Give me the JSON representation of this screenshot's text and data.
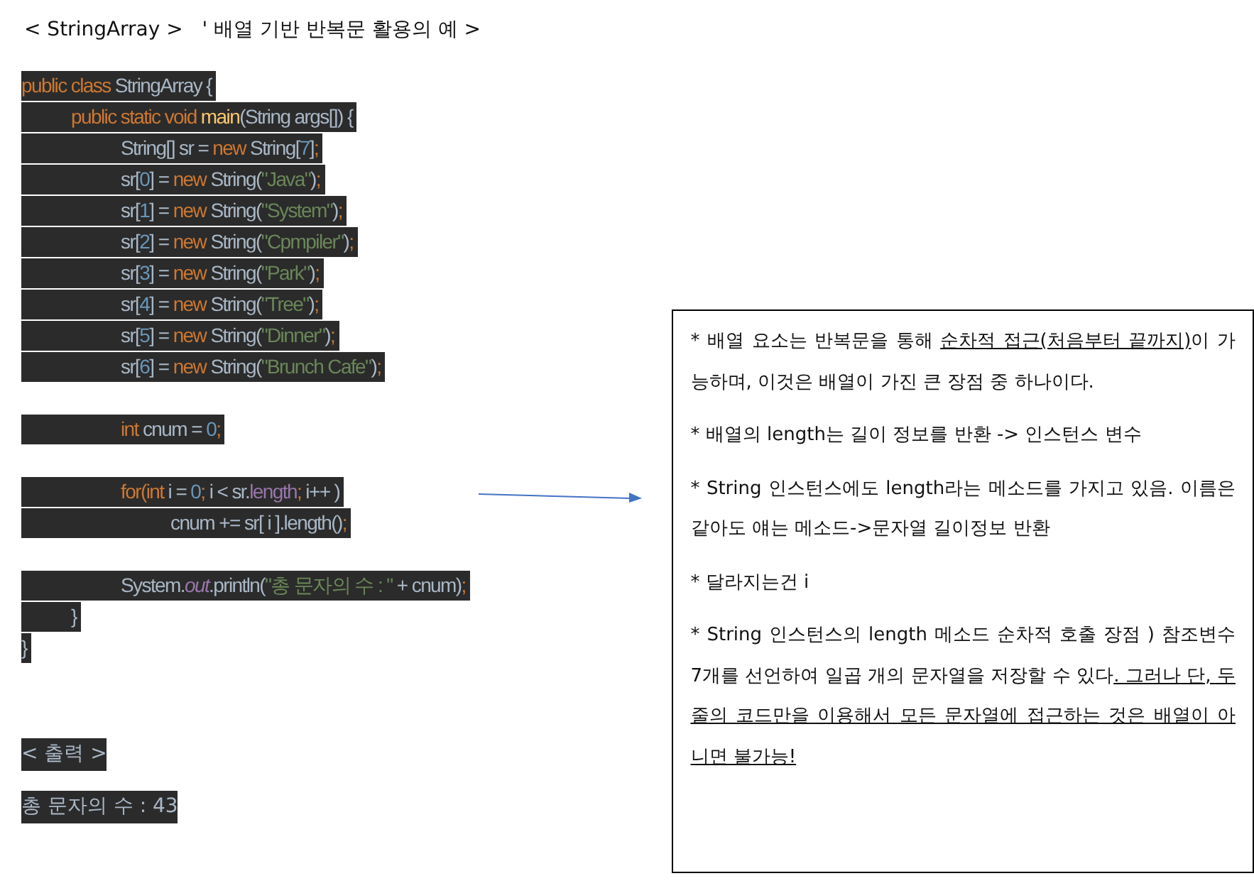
{
  "title": "< StringArray >   ' 배열 기반 반복문 활용의 예 >",
  "code": {
    "tokens": [
      {
        "kind": "keyword",
        "text": "public class "
      },
      {
        "kind": "plain",
        "text": "StringArray {"
      }
    ],
    "closing": [
      {
        "kind": "plain",
        "text": "}"
      }
    ],
    "groups": [
      [
        {
          "tokens": [
            {
              "kind": "keyword",
              "text": "public static void "
            },
            {
              "kind": "method",
              "text": "main"
            },
            {
              "kind": "plain",
              "text": "(String args[]) {"
            }
          ],
          "closing": [
            {
              "kind": "plain",
              "text": "}"
            }
          ],
          "groups": [
            [
              {
                "tokens": [
                  {
                    "kind": "plain",
                    "text": "String[] sr = "
                  },
                  {
                    "kind": "keyword",
                    "text": "new "
                  },
                  {
                    "kind": "plain",
                    "text": "String["
                  },
                  {
                    "kind": "number",
                    "text": "7"
                  },
                  {
                    "kind": "plain",
                    "text": "]"
                  },
                  {
                    "kind": "keyword",
                    "text": ";"
                  }
                ]
              },
              {
                "tokens": [
                  {
                    "kind": "plain",
                    "text": "sr["
                  },
                  {
                    "kind": "number",
                    "text": "0"
                  },
                  {
                    "kind": "plain",
                    "text": "] = "
                  },
                  {
                    "kind": "keyword",
                    "text": "new "
                  },
                  {
                    "kind": "plain",
                    "text": "String("
                  },
                  {
                    "kind": "string",
                    "text": "\"Java\""
                  },
                  {
                    "kind": "plain",
                    "text": ")"
                  },
                  {
                    "kind": "keyword",
                    "text": ";"
                  }
                ]
              },
              {
                "tokens": [
                  {
                    "kind": "plain",
                    "text": "sr["
                  },
                  {
                    "kind": "number",
                    "text": "1"
                  },
                  {
                    "kind": "plain",
                    "text": "] = "
                  },
                  {
                    "kind": "keyword",
                    "text": "new "
                  },
                  {
                    "kind": "plain",
                    "text": "String("
                  },
                  {
                    "kind": "string",
                    "text": "\"System\""
                  },
                  {
                    "kind": "plain",
                    "text": ")"
                  },
                  {
                    "kind": "keyword",
                    "text": ";"
                  }
                ]
              },
              {
                "tokens": [
                  {
                    "kind": "plain",
                    "text": "sr["
                  },
                  {
                    "kind": "number",
                    "text": "2"
                  },
                  {
                    "kind": "plain",
                    "text": "] = "
                  },
                  {
                    "kind": "keyword",
                    "text": "new "
                  },
                  {
                    "kind": "plain",
                    "text": "String("
                  },
                  {
                    "kind": "string",
                    "text": "\"Cpmpiler\""
                  },
                  {
                    "kind": "plain",
                    "text": ")"
                  },
                  {
                    "kind": "keyword",
                    "text": ";"
                  }
                ]
              },
              {
                "tokens": [
                  {
                    "kind": "plain",
                    "text": "sr["
                  },
                  {
                    "kind": "number",
                    "text": "3"
                  },
                  {
                    "kind": "plain",
                    "text": "] = "
                  },
                  {
                    "kind": "keyword",
                    "text": "new "
                  },
                  {
                    "kind": "plain",
                    "text": "String("
                  },
                  {
                    "kind": "string",
                    "text": "\"Park\""
                  },
                  {
                    "kind": "plain",
                    "text": ")"
                  },
                  {
                    "kind": "keyword",
                    "text": ";"
                  }
                ]
              },
              {
                "tokens": [
                  {
                    "kind": "plain",
                    "text": "sr["
                  },
                  {
                    "kind": "number",
                    "text": "4"
                  },
                  {
                    "kind": "plain",
                    "text": "] = "
                  },
                  {
                    "kind": "keyword",
                    "text": "new "
                  },
                  {
                    "kind": "plain",
                    "text": "String("
                  },
                  {
                    "kind": "string",
                    "text": "\"Tree\""
                  },
                  {
                    "kind": "plain",
                    "text": ")"
                  },
                  {
                    "kind": "keyword",
                    "text": ";"
                  }
                ]
              },
              {
                "tokens": [
                  {
                    "kind": "plain",
                    "text": "sr["
                  },
                  {
                    "kind": "number",
                    "text": "5"
                  },
                  {
                    "kind": "plain",
                    "text": "] = "
                  },
                  {
                    "kind": "keyword",
                    "text": "new "
                  },
                  {
                    "kind": "plain",
                    "text": "String("
                  },
                  {
                    "kind": "string",
                    "text": "\"Dinner\""
                  },
                  {
                    "kind": "plain",
                    "text": ")"
                  },
                  {
                    "kind": "keyword",
                    "text": ";"
                  }
                ]
              },
              {
                "tokens": [
                  {
                    "kind": "plain",
                    "text": "sr["
                  },
                  {
                    "kind": "number",
                    "text": "6"
                  },
                  {
                    "kind": "plain",
                    "text": "] = "
                  },
                  {
                    "kind": "keyword",
                    "text": "new "
                  },
                  {
                    "kind": "plain",
                    "text": "String("
                  },
                  {
                    "kind": "string",
                    "text": "\"Brunch Cafe\""
                  },
                  {
                    "kind": "plain",
                    "text": ")"
                  },
                  {
                    "kind": "keyword",
                    "text": ";"
                  }
                ]
              }
            ],
            [
              {
                "tokens": [
                  {
                    "kind": "keyword",
                    "text": "int "
                  },
                  {
                    "kind": "plain",
                    "text": "cnum = "
                  },
                  {
                    "kind": "number",
                    "text": "0"
                  },
                  {
                    "kind": "keyword",
                    "text": ";"
                  }
                ]
              }
            ],
            [
              {
                "tokens": [
                  {
                    "kind": "keyword",
                    "text": "for("
                  },
                  {
                    "kind": "keyword",
                    "text": "int "
                  },
                  {
                    "kind": "plain",
                    "text": "i = "
                  },
                  {
                    "kind": "number",
                    "text": "0"
                  },
                  {
                    "kind": "keyword",
                    "text": "; "
                  },
                  {
                    "kind": "plain",
                    "text": "i < sr."
                  },
                  {
                    "kind": "field",
                    "text": "length"
                  },
                  {
                    "kind": "keyword",
                    "text": "; "
                  },
                  {
                    "kind": "plain",
                    "text": "i++ )"
                  }
                ],
                "groups": [
                  [
                    {
                      "tokens": [
                        {
                          "kind": "plain",
                          "text": "cnum += sr[ i ].length()"
                        },
                        {
                          "kind": "keyword",
                          "text": ";"
                        }
                      ]
                    }
                  ]
                ]
              }
            ],
            [
              {
                "tokens": [
                  {
                    "kind": "plain",
                    "text": "System."
                  },
                  {
                    "kind": "static",
                    "text": "out"
                  },
                  {
                    "kind": "plain",
                    "text": ".println("
                  },
                  {
                    "kind": "string",
                    "text": "\"총 문자의 수 : \""
                  },
                  {
                    "kind": "plain",
                    "text": " + cnum)"
                  },
                  {
                    "kind": "keyword",
                    "text": ";"
                  }
                ]
              }
            ]
          ]
        }
      ]
    ]
  },
  "output_heading": "< 출력 >",
  "output_result": "총 문자의 수 : 43",
  "notes": [
    [
      {
        "text": "* 배열 요소는 반복문을 통해 ",
        "underline": false
      },
      {
        "text": "순차적 접근(처음부터 끝까지)",
        "underline": true
      },
      {
        "text": "이 가능하며, 이것은 배열이 가진 큰 장점 중 하나이다.",
        "underline": false
      }
    ],
    [
      {
        "text": "* 배열의 length는 길이 정보를 반환 -> 인스턴스 변수",
        "underline": false
      }
    ],
    [
      {
        "text": "* String 인스턴스에도 length라는 메소드를 가지고 있음. 이름은 같아도 얘는 메소드->문자열 길이정보 반환",
        "underline": false
      }
    ],
    [
      {
        "text": "* 달라지는건 i",
        "underline": false
      }
    ],
    [
      {
        "text": "* String 인스턴스의 length 메소드 순차적 호출 장점 ) 참조변수 7개를 선언하여 일곱 개의 문자열을 저장할 수 있다",
        "underline": false
      },
      {
        "text": ". 그러나 단, 두 줄의 코드만을 이용해서 모든 문자열에 접근하는 것은 배열이 아니면 불가능!",
        "underline": true
      }
    ]
  ]
}
